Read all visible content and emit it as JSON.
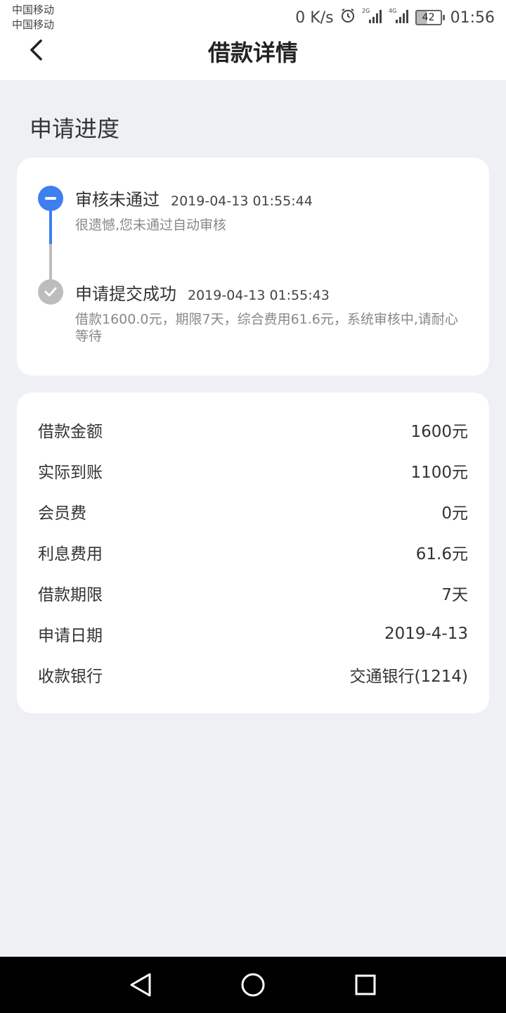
{
  "status_bar": {
    "carrier1": "中国移动",
    "carrier2": "中国移动",
    "speed": "0 K/s",
    "net1": "2G",
    "net2": "4G",
    "battery": "42",
    "time": "01:56"
  },
  "header": {
    "title": "借款详情"
  },
  "progress": {
    "section_title": "申请进度",
    "events": [
      {
        "title": "审核未通过",
        "time": "2019-04-13 01:55:44",
        "desc": "很遗憾,您未通过自动审核"
      },
      {
        "title": "申请提交成功",
        "time": "2019-04-13 01:55:43",
        "desc": "借款1600.0元，期限7天，综合费用61.6元，系统审核中,请耐心等待"
      }
    ]
  },
  "details": [
    {
      "label": "借款金额",
      "value": "1600元"
    },
    {
      "label": "实际到账",
      "value": "1100元"
    },
    {
      "label": "会员费",
      "value": "0元"
    },
    {
      "label": "利息费用",
      "value": "61.6元"
    },
    {
      "label": "借款期限",
      "value": "7天"
    },
    {
      "label": "申请日期",
      "value": "2019-4-13"
    },
    {
      "label": "收款银行",
      "value": "交通银行(1214)"
    }
  ],
  "colors": {
    "accent": "#3e7ff0",
    "inactive": "#bdbdbd",
    "background": "#eef0f4"
  }
}
